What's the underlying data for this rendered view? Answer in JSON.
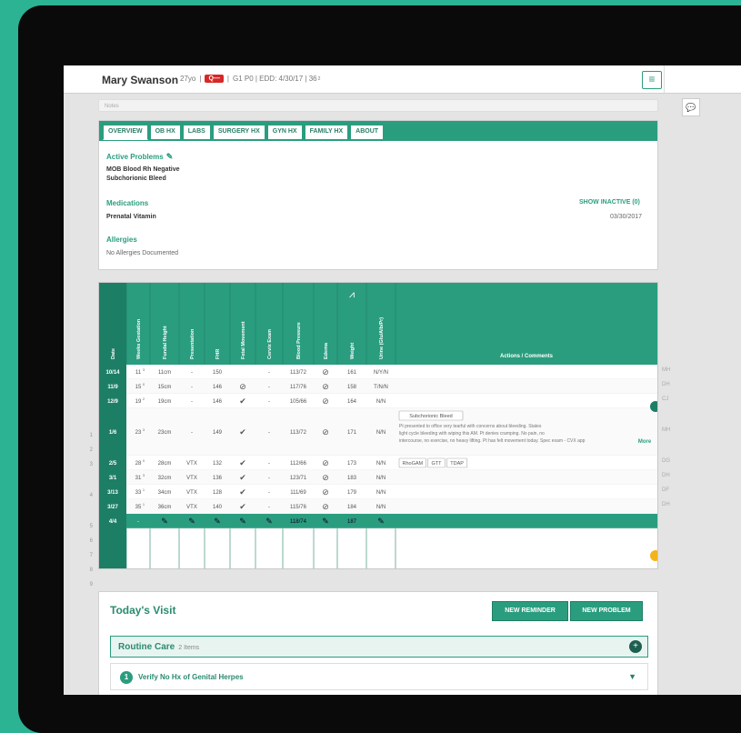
{
  "patient": {
    "name": "Mary Swanson",
    "age": "27yo",
    "badge": "Q—",
    "info": "G1 P0 | EDD: 4/30/17 | 36",
    "ga_sup": "2"
  },
  "notes_placeholder": "Notes",
  "tabs": [
    "OVERVIEW",
    "OB HX",
    "LABS",
    "SURGERY HX",
    "GYN HX",
    "FAMILY HX",
    "ABOUT"
  ],
  "overview": {
    "problems_heading": "Active Problems",
    "problems": [
      "MOB Blood Rh Negative",
      "Subchorionic Bleed"
    ],
    "meds_heading": "Medications",
    "show_inactive": "SHOW INACTIVE (0)",
    "med_name": "Prenatal Vitamin",
    "med_date": "03/30/2017",
    "allergies_heading": "Allergies",
    "allergies_text": "No Allergies Documented"
  },
  "grid": {
    "headers": [
      "Date",
      "Weeks Gestation",
      "Fundal Height",
      "Presentation",
      "FHR",
      "Fetal Movement",
      "Cervix Exam",
      "Blood Pressure",
      "Edema",
      "Weight",
      "Urine (Glu/Alb/Pr)",
      "Actions / Comments"
    ],
    "rows": [
      {
        "num": "1",
        "date": "10/14",
        "wg": "11",
        "wgs": "3",
        "fh": "11cm",
        "pres": "-",
        "fhr": "150",
        "fm": "",
        "cx": "-",
        "bp": "113/72",
        "ed": "⊘",
        "wt": "161",
        "ur": "N/Y/N",
        "time": "MH"
      },
      {
        "num": "2",
        "date": "11/9",
        "wg": "15",
        "wgs": "0",
        "fh": "15cm",
        "pres": "-",
        "fhr": "146",
        "fm": "⊘",
        "cx": "-",
        "bp": "117/76",
        "ed": "⊘",
        "wt": "158",
        "ur": "T/N/N",
        "time": "DH"
      },
      {
        "num": "3",
        "date": "12/9",
        "wg": "19",
        "wgs": "2",
        "fh": "19cm",
        "pres": "-",
        "fhr": "146",
        "fm": "✔",
        "cx": "-",
        "bp": "105/66",
        "ed": "⊘",
        "wt": "164",
        "ur": "N/N",
        "time": "CJ"
      },
      {
        "num": "4",
        "date": "1/6",
        "wg": "23",
        "wgs": "3",
        "fh": "23cm",
        "pres": "-",
        "fhr": "149",
        "fm": "✔",
        "cx": "-",
        "bp": "113/72",
        "ed": "⊘",
        "wt": "171",
        "ur": "N/N",
        "time": "MH"
      },
      {
        "num": "5",
        "date": "2/5",
        "wg": "28",
        "wgs": "0",
        "fh": "28cm",
        "pres": "VTX",
        "fhr": "132",
        "fm": "✔",
        "cx": "-",
        "bp": "112/66",
        "ed": "⊘",
        "wt": "173",
        "ur": "N/N",
        "time": "DG"
      },
      {
        "num": "6",
        "date": "3/1",
        "wg": "31",
        "wgs": "3",
        "fh": "32cm",
        "pres": "VTX",
        "fhr": "136",
        "fm": "✔",
        "cx": "-",
        "bp": "123/71",
        "ed": "⊘",
        "wt": "183",
        "ur": "N/N",
        "time": "DH"
      },
      {
        "num": "7",
        "date": "3/13",
        "wg": "33",
        "wgs": "1",
        "fh": "34cm",
        "pres": "VTX",
        "fhr": "128",
        "fm": "✔",
        "cx": "-",
        "bp": "111/69",
        "ed": "⊘",
        "wt": "179",
        "ur": "N/N",
        "time": "DF"
      },
      {
        "num": "8",
        "date": "3/27",
        "wg": "35",
        "wgs": "1",
        "fh": "36cm",
        "pres": "VTX",
        "fhr": "140",
        "fm": "✔",
        "cx": "-",
        "bp": "115/76",
        "ed": "⊘",
        "wt": "184",
        "ur": "N/N",
        "time": "DH"
      },
      {
        "num": "9",
        "date": "4/4",
        "wg": "-",
        "wgs": "",
        "fh": "✎",
        "pres": "✎",
        "fhr": "✎",
        "fm": "✎",
        "cx": "✎",
        "bp": "118/74",
        "ed": "✎",
        "wt": "187",
        "ur": "✎",
        "time": ""
      }
    ],
    "row4_tag": "Subchorionic Bleed",
    "row4_comment": "Pt presented to office very tearful with concerns about bleeding. States light cycle bleeding with wiping this AM. Pt denies cramping. No pain, no intercourse, no exercise, no heavy lifting. Pt has felt movement today. Spec exam - CVX app",
    "row4_more": "More",
    "row5_tags": [
      "RhoGAM",
      "GTT",
      "TDAP"
    ]
  },
  "visit": {
    "title": "Today's Visit",
    "new_reminder": "NEW REMINDER",
    "new_problem": "NEW PROBLEM",
    "routine_title": "Routine Care",
    "routine_count": "2 Items",
    "item_num": "1",
    "item_label": "Verify No Hx of Genital Herpes"
  },
  "colors": {
    "brand": "#2a9d7f",
    "dark": "#1d7e66",
    "alert": "#d62828"
  }
}
